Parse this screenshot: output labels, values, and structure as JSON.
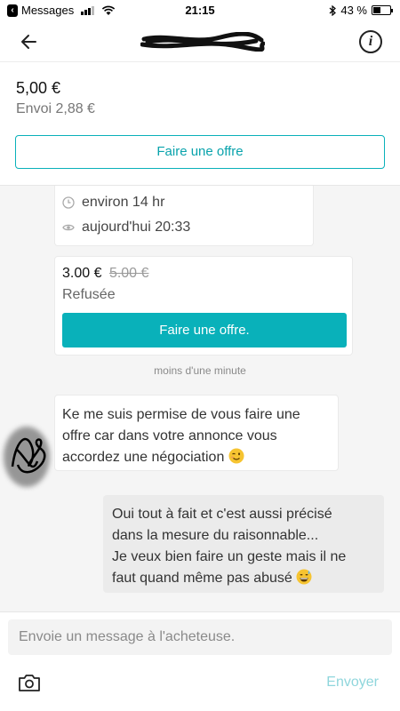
{
  "status_bar": {
    "back_app": "Messages",
    "time": "21:15",
    "battery": "43 %"
  },
  "header": {
    "title_redacted": true
  },
  "item": {
    "price": "5,00 €",
    "shipping": "Envoi 2,88 €",
    "offer_button": "Faire une offre"
  },
  "meta": {
    "duration": "environ 14 hr",
    "seen": "aujourd'hui 20:33"
  },
  "offer": {
    "price": "3.00 €",
    "old_price": "5.00 €",
    "status": "Refusée",
    "button": "Faire une offre."
  },
  "chat": {
    "timestamp": "moins d'une minute",
    "messages": [
      {
        "side": "left",
        "lines": [
          "Ke me suis permise de vous faire une",
          "offre car dans votre annonce vous",
          "accordez une négociation"
        ],
        "emoji": "winking-face"
      },
      {
        "side": "right",
        "lines": [
          "Oui tout à fait et c'est aussi précisé",
          "dans la mesure du raisonnable...",
          "Je veux bien faire un geste mais il ne",
          "faut quand même pas abusé"
        ],
        "emoji": "grinning-sweat-face"
      }
    ]
  },
  "composer": {
    "placeholder": "Envoie un message à l'acheteuse.",
    "send": "Envoyer"
  },
  "colors": {
    "accent": "#09b1ba",
    "send_disabled": "#8fd6dc",
    "bubble_right": "#ebebeb"
  }
}
